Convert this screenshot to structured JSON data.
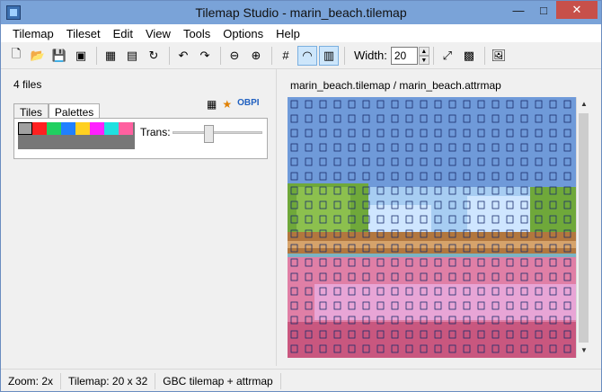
{
  "window": {
    "title": "Tilemap Studio - marin_beach.tilemap"
  },
  "menu": [
    "Tilemap",
    "Tileset",
    "Edit",
    "View",
    "Tools",
    "Options",
    "Help"
  ],
  "toolbar": {
    "icons": [
      "new-file",
      "open",
      "save",
      "export",
      "tileset",
      "add-tileset",
      "reload",
      "undo",
      "redo",
      "zoom-out",
      "zoom-in",
      "grid",
      "rainbow",
      "attributes"
    ],
    "width_label": "Width:",
    "width_value": "20",
    "right_icons": [
      "resize",
      "image",
      "picture"
    ]
  },
  "left": {
    "files_count": "4 files",
    "tabs": [
      "Tiles",
      "Palettes"
    ],
    "trans_label": "Trans:",
    "palette_colors": [
      "#ff2020",
      "#20d060",
      "#2080ff",
      "#ffd020",
      "#ff20ff",
      "#20e0e0",
      "#ff60a0"
    ]
  },
  "map": {
    "path": "marin_beach.tilemap / marin_beach.attrmap"
  },
  "status": {
    "zoom": "Zoom: 2x",
    "tilemap": "Tilemap: 20 x 32",
    "format": "GBC tilemap + attrmap"
  }
}
